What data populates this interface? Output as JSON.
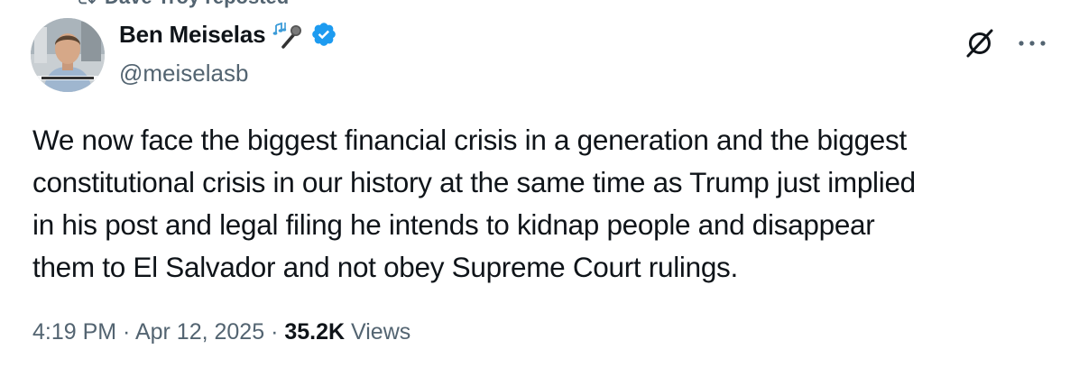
{
  "repost": {
    "label": "Dave Troy reposted"
  },
  "author": {
    "display_name": "Ben Meiselas",
    "handle": "@meiselasb",
    "verified": true,
    "emoji": "musical-notes-microphone"
  },
  "tweet": {
    "lines": [
      "We now face the biggest financial crisis in a generation and the biggest",
      "constitutional crisis in our history at the same time as Trump just implied",
      "in his post and legal filing he intends to kidnap people and disappear",
      "them to El Salvador and not obey Supreme Court rulings."
    ]
  },
  "meta": {
    "time": "4:19 PM",
    "sep1": " · ",
    "date": "Apr 12, 2025",
    "sep2": " · ",
    "views_count": "35.2K",
    "views_label": " Views"
  },
  "colors": {
    "text_primary": "#0f1419",
    "text_secondary": "#536471",
    "verified_blue": "#1d9bf0"
  }
}
